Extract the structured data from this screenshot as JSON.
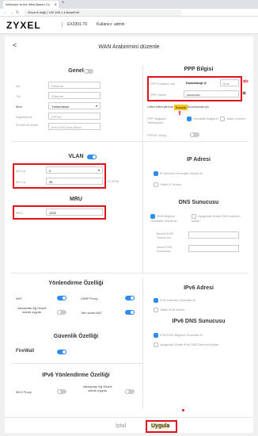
{
  "browser": {
    "tab_title": "Welcome to the Web-Based Co",
    "address": "Güvenli değil | 192.168.1.1/#wanEdit"
  },
  "header": {
    "logo": "ZYXEL",
    "model": "EX3301-T0",
    "user": "Kullanıcı: admin"
  },
  "page": {
    "title": "WAN Arabirimini düzenle",
    "back": "<"
  },
  "general": {
    "title": "Genel",
    "name_label": "Ad",
    "name_value": "Ethernet",
    "type_label": "Tür",
    "type_value": "Ethernet",
    "mode_label": "Mod",
    "mode_value": "Yönlendirme",
    "encap_label": "Kapsülleme",
    "encap_value": "PPPoE",
    "ipv_label": "IPv4/IPv6 Modu",
    "ipv_value": "IPv4 IPv6 Dual Stack"
  },
  "ppp": {
    "title": "PPP Bilgisi",
    "user_label": "PPP Kullanıcı Adı",
    "user_value": "fisetokoloji @",
    "user_suffix": "ttnet",
    "pass_label": "PPP Şifresi",
    "pass_value": "••••••••••••",
    "hint": "Lütfen lütfen şifrenizi değer ISS'tel kullanmak için",
    "tooltip": "Burada",
    "conn_label": "PPP Bağlantı Tetikleyicisi",
    "conn_opt1": "Otomatik Bağlantı",
    "conn_opt2": "Talep Üzerine",
    "passthrough_label": "PPPoE Geçiş"
  },
  "vlan": {
    "title": "VLAN",
    "p_label": "802.1p",
    "p_value": "0",
    "q_label": "802.1q",
    "q_value": "35",
    "q_hint": "(1~4094)"
  },
  "mru": {
    "title": "MRU",
    "label": "MRU",
    "value": "1492"
  },
  "ip": {
    "title": "IP Adresi",
    "opt1": "IP Adresini Otomatik Olarak Al",
    "opt2": "Statik IP Adresi"
  },
  "dns": {
    "title": "DNS Sunucusu",
    "opt1": "DNS Bilgisini Otomatik Olarak Al",
    "opt2": "Aşağıdaki Statik DNS Adresini kullan",
    "primary": "Birincil DNS Sunucusu",
    "secondary": "İkincil DNS Sunucusu"
  },
  "routing": {
    "title": "Yönlendirme Özelliği",
    "nat": "NAT",
    "igmp": "IGMP Proxy",
    "default_gw": "Varsayılan Ağ Geçidi olarak uygula",
    "fullcone": "Tam konik NAT"
  },
  "ipv6": {
    "title": "IPv6 Adresi",
    "opt1": "IPv6 Adresini Otomatik Al",
    "opt2": "Statik IPv6 Adresi",
    "dns_title": "IPv6 DNS Sunucusu",
    "dns_opt1": "IPv6 DNS Bilgisini Otomatik Al",
    "dns_opt2": "Aşağıdaki Statik IPv6 DNS Adresini kullan"
  },
  "security": {
    "title": "Güvenlik Özelliği",
    "firewall": "FireWall"
  },
  "ipv6_routing": {
    "title": "IPv6 Yönlendirme Özelliği",
    "mld": "MLD Proxy",
    "default_gw": "Varsayılan Ağ Geçidi olarak uygula"
  },
  "footer": {
    "cancel": "İptal",
    "apply": "Uygula"
  },
  "colors": {
    "accent": "#2f8cf0",
    "highlight": "#e0121b",
    "tooltip": "#f5c518"
  }
}
